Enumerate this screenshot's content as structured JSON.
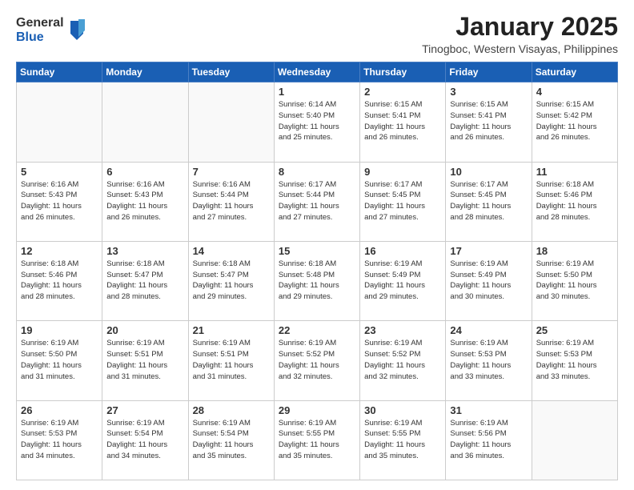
{
  "logo": {
    "general": "General",
    "blue": "Blue"
  },
  "title": "January 2025",
  "location": "Tinogboc, Western Visayas, Philippines",
  "weekdays": [
    "Sunday",
    "Monday",
    "Tuesday",
    "Wednesday",
    "Thursday",
    "Friday",
    "Saturday"
  ],
  "weeks": [
    [
      {
        "day": "",
        "info": ""
      },
      {
        "day": "",
        "info": ""
      },
      {
        "day": "",
        "info": ""
      },
      {
        "day": "1",
        "info": "Sunrise: 6:14 AM\nSunset: 5:40 PM\nDaylight: 11 hours\nand 25 minutes."
      },
      {
        "day": "2",
        "info": "Sunrise: 6:15 AM\nSunset: 5:41 PM\nDaylight: 11 hours\nand 26 minutes."
      },
      {
        "day": "3",
        "info": "Sunrise: 6:15 AM\nSunset: 5:41 PM\nDaylight: 11 hours\nand 26 minutes."
      },
      {
        "day": "4",
        "info": "Sunrise: 6:15 AM\nSunset: 5:42 PM\nDaylight: 11 hours\nand 26 minutes."
      }
    ],
    [
      {
        "day": "5",
        "info": "Sunrise: 6:16 AM\nSunset: 5:43 PM\nDaylight: 11 hours\nand 26 minutes."
      },
      {
        "day": "6",
        "info": "Sunrise: 6:16 AM\nSunset: 5:43 PM\nDaylight: 11 hours\nand 26 minutes."
      },
      {
        "day": "7",
        "info": "Sunrise: 6:16 AM\nSunset: 5:44 PM\nDaylight: 11 hours\nand 27 minutes."
      },
      {
        "day": "8",
        "info": "Sunrise: 6:17 AM\nSunset: 5:44 PM\nDaylight: 11 hours\nand 27 minutes."
      },
      {
        "day": "9",
        "info": "Sunrise: 6:17 AM\nSunset: 5:45 PM\nDaylight: 11 hours\nand 27 minutes."
      },
      {
        "day": "10",
        "info": "Sunrise: 6:17 AM\nSunset: 5:45 PM\nDaylight: 11 hours\nand 28 minutes."
      },
      {
        "day": "11",
        "info": "Sunrise: 6:18 AM\nSunset: 5:46 PM\nDaylight: 11 hours\nand 28 minutes."
      }
    ],
    [
      {
        "day": "12",
        "info": "Sunrise: 6:18 AM\nSunset: 5:46 PM\nDaylight: 11 hours\nand 28 minutes."
      },
      {
        "day": "13",
        "info": "Sunrise: 6:18 AM\nSunset: 5:47 PM\nDaylight: 11 hours\nand 28 minutes."
      },
      {
        "day": "14",
        "info": "Sunrise: 6:18 AM\nSunset: 5:47 PM\nDaylight: 11 hours\nand 29 minutes."
      },
      {
        "day": "15",
        "info": "Sunrise: 6:18 AM\nSunset: 5:48 PM\nDaylight: 11 hours\nand 29 minutes."
      },
      {
        "day": "16",
        "info": "Sunrise: 6:19 AM\nSunset: 5:49 PM\nDaylight: 11 hours\nand 29 minutes."
      },
      {
        "day": "17",
        "info": "Sunrise: 6:19 AM\nSunset: 5:49 PM\nDaylight: 11 hours\nand 30 minutes."
      },
      {
        "day": "18",
        "info": "Sunrise: 6:19 AM\nSunset: 5:50 PM\nDaylight: 11 hours\nand 30 minutes."
      }
    ],
    [
      {
        "day": "19",
        "info": "Sunrise: 6:19 AM\nSunset: 5:50 PM\nDaylight: 11 hours\nand 31 minutes."
      },
      {
        "day": "20",
        "info": "Sunrise: 6:19 AM\nSunset: 5:51 PM\nDaylight: 11 hours\nand 31 minutes."
      },
      {
        "day": "21",
        "info": "Sunrise: 6:19 AM\nSunset: 5:51 PM\nDaylight: 11 hours\nand 31 minutes."
      },
      {
        "day": "22",
        "info": "Sunrise: 6:19 AM\nSunset: 5:52 PM\nDaylight: 11 hours\nand 32 minutes."
      },
      {
        "day": "23",
        "info": "Sunrise: 6:19 AM\nSunset: 5:52 PM\nDaylight: 11 hours\nand 32 minutes."
      },
      {
        "day": "24",
        "info": "Sunrise: 6:19 AM\nSunset: 5:53 PM\nDaylight: 11 hours\nand 33 minutes."
      },
      {
        "day": "25",
        "info": "Sunrise: 6:19 AM\nSunset: 5:53 PM\nDaylight: 11 hours\nand 33 minutes."
      }
    ],
    [
      {
        "day": "26",
        "info": "Sunrise: 6:19 AM\nSunset: 5:53 PM\nDaylight: 11 hours\nand 34 minutes."
      },
      {
        "day": "27",
        "info": "Sunrise: 6:19 AM\nSunset: 5:54 PM\nDaylight: 11 hours\nand 34 minutes."
      },
      {
        "day": "28",
        "info": "Sunrise: 6:19 AM\nSunset: 5:54 PM\nDaylight: 11 hours\nand 35 minutes."
      },
      {
        "day": "29",
        "info": "Sunrise: 6:19 AM\nSunset: 5:55 PM\nDaylight: 11 hours\nand 35 minutes."
      },
      {
        "day": "30",
        "info": "Sunrise: 6:19 AM\nSunset: 5:55 PM\nDaylight: 11 hours\nand 35 minutes."
      },
      {
        "day": "31",
        "info": "Sunrise: 6:19 AM\nSunset: 5:56 PM\nDaylight: 11 hours\nand 36 minutes."
      },
      {
        "day": "",
        "info": ""
      }
    ]
  ]
}
